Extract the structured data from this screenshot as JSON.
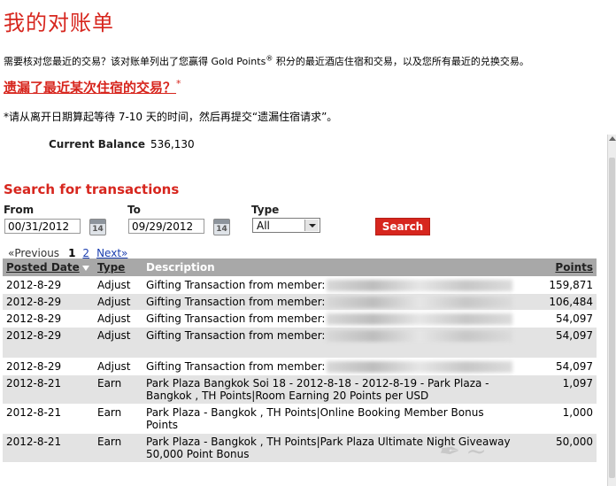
{
  "page": {
    "title": "我的对账单",
    "intro_before": "需要核对您最近的交易？该对账单列出了您赢得 Gold Points",
    "intro_sup": "®",
    "intro_after": " 积分的最近酒店住宿和交易，以及您所有最近的兑换交易。",
    "missing_stay_link": "遗漏了最近某次住宿的交易？",
    "asterisk": "*",
    "note": "*请从离开日期算起等待 7-10 天的时间，然后再提交“遗漏住宿请求”。",
    "balance_label": "Current Balance",
    "balance_value": "536,130"
  },
  "search": {
    "heading": "Search for transactions",
    "from_label": "From",
    "from_value": "00/31/2012",
    "to_label": "To",
    "to_value": "09/29/2012",
    "calendar_number": "14",
    "type_label": "Type",
    "type_value": "All",
    "button_label": "Search"
  },
  "pager": {
    "previous": "«Previous",
    "current": "1",
    "page2": "2",
    "next": "Next»"
  },
  "table": {
    "headers": {
      "posted_date": "Posted Date",
      "type": "Type",
      "description": "Description",
      "points": "Points"
    },
    "rows": [
      {
        "date": "2012-8-29",
        "type": "Adjust",
        "desc": "Gifting Transaction from member:",
        "desc2": "",
        "points": "159,871"
      },
      {
        "date": "2012-8-29",
        "type": "Adjust",
        "desc": "Gifting Transaction from member:",
        "desc2": "",
        "points": "106,484"
      },
      {
        "date": "2012-8-29",
        "type": "Adjust",
        "desc": "Gifting Transaction from member:",
        "desc2": "",
        "points": "54,097"
      },
      {
        "date": "2012-8-29",
        "type": "Adjust",
        "desc": "Gifting Transaction from member:",
        "desc2": "",
        "points": "54,097"
      },
      {
        "date": "2012-8-29",
        "type": "Adjust",
        "desc": "Gifting Transaction from member:",
        "desc2": "",
        "points": "54,097"
      },
      {
        "date": "2012-8-21",
        "type": "Earn",
        "desc": "Park Plaza Bangkok Soi 18 - 2012-8-18 - 2012-8-19 - Park Plaza -",
        "desc2": "Bangkok , TH Points|Room Earning 20 Points per USD",
        "points": "1,097"
      },
      {
        "date": "2012-8-21",
        "type": "Earn",
        "desc": "Park Plaza - Bangkok , TH Points|Online Booking Member Bonus",
        "desc2": "Points",
        "points": "1,000"
      },
      {
        "date": "2012-8-21",
        "type": "Earn",
        "desc": "Park Plaza - Bangkok , TH Points|Park Plaza Ultimate Night Giveaway",
        "desc2": "50,000 Point Bonus",
        "points": "50,000"
      }
    ]
  },
  "colors": {
    "brand_red": "#d7261e",
    "header_gray": "#a8a8a8",
    "row_shade": "#e3e3e3"
  }
}
